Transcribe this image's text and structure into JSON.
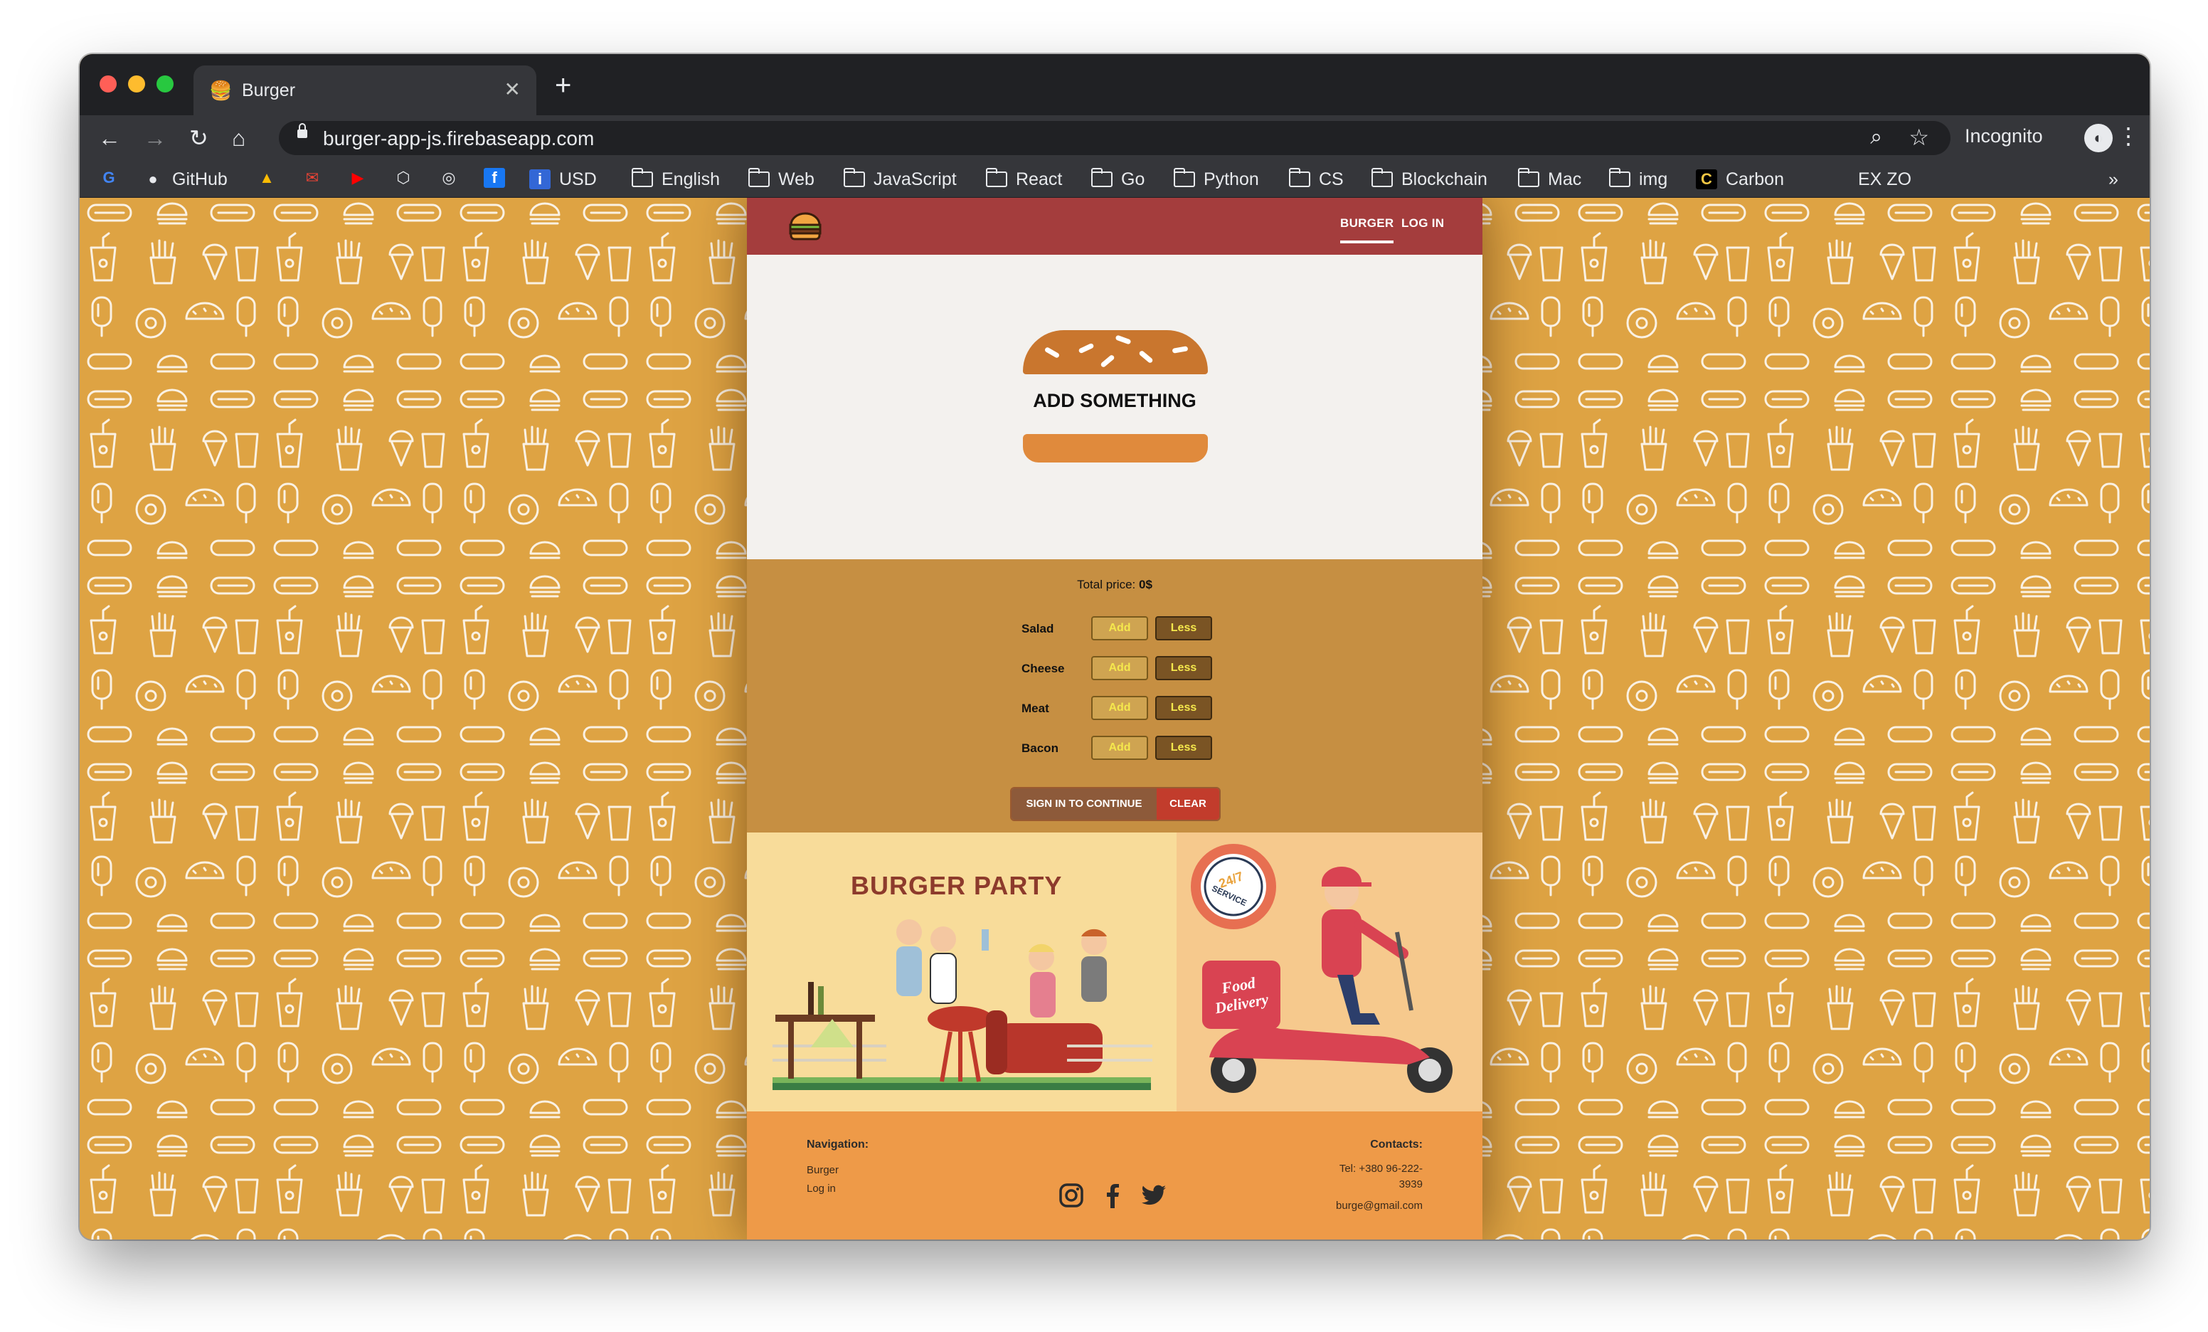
{
  "browser": {
    "tab_title": "Burger",
    "url": "burger-app-js.firebaseapp.com",
    "incognito_label": "Incognito",
    "bookmarks": [
      {
        "label": "GitHub",
        "icon": "github-icon"
      },
      {
        "label": "USD",
        "icon": "info-icon"
      },
      {
        "label": "English",
        "icon": "folder-icon"
      },
      {
        "label": "Web",
        "icon": "folder-icon"
      },
      {
        "label": "JavaScript",
        "icon": "folder-icon"
      },
      {
        "label": "React",
        "icon": "folder-icon"
      },
      {
        "label": "Go",
        "icon": "folder-icon"
      },
      {
        "label": "Python",
        "icon": "folder-icon"
      },
      {
        "label": "CS",
        "icon": "folder-icon"
      },
      {
        "label": "Blockchain",
        "icon": "folder-icon"
      },
      {
        "label": "Mac",
        "icon": "folder-icon"
      },
      {
        "label": "img",
        "icon": "folder-icon"
      },
      {
        "label": "Carbon",
        "icon": "carbon-icon"
      },
      {
        "label": "EX ZO",
        "icon": "blank-icon"
      }
    ],
    "overflow": "»"
  },
  "app": {
    "nav": {
      "burger": "BURGER",
      "login": "LOG IN"
    },
    "preview_label": "ADD SOMETHING",
    "total_label": "Total price:",
    "total_value": "0$",
    "ingredients": [
      {
        "label": "Salad",
        "add": "Add",
        "less": "Less"
      },
      {
        "label": "Cheese",
        "add": "Add",
        "less": "Less"
      },
      {
        "label": "Meat",
        "add": "Add",
        "less": "Less"
      },
      {
        "label": "Bacon",
        "add": "Add",
        "less": "Less"
      }
    ],
    "sign_in_button": "SIGN IN TO CONTINUE",
    "clear_button": "CLEAR",
    "banner_party_title": "BURGER PARTY",
    "banner_badge_top": "24/7",
    "banner_badge_bottom": "SERVICE",
    "banner_box_text_1": "Food",
    "banner_box_text_2": "Delivery",
    "footer": {
      "nav_heading": "Navigation:",
      "nav_links": [
        "Burger",
        "Log in"
      ],
      "contacts_heading": "Contacts:",
      "tel_1": "Tel: +380 96-222-",
      "tel_2": "3939",
      "email": "burge@gmail.com"
    },
    "colors": {
      "header": "#a43d3d",
      "background": "#dea343",
      "controls": "#c68f42",
      "footer": "#ee9a48"
    }
  }
}
